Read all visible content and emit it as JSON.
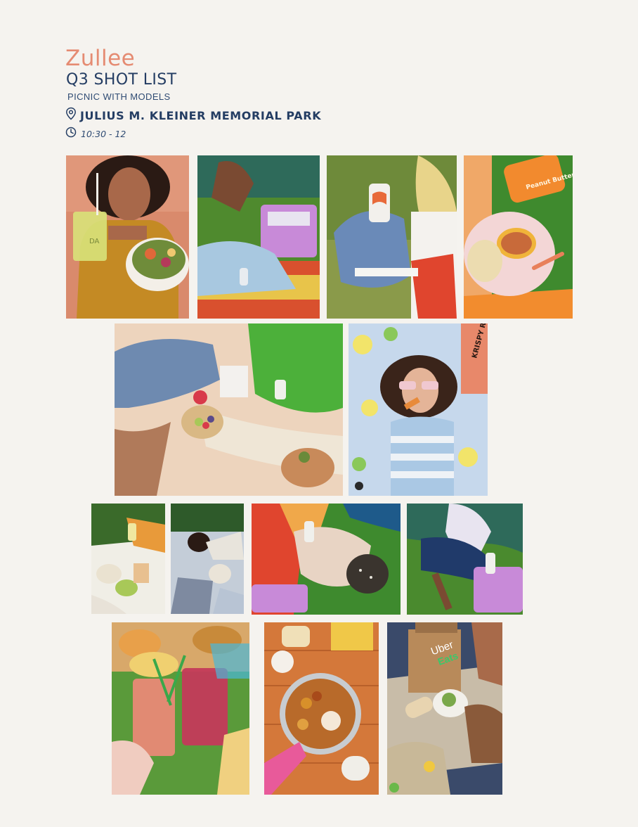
{
  "header": {
    "brand": "Zullee",
    "title": "Q3 SHOT LIST",
    "subtitle": "PICNIC WITH MODELS",
    "location": "JULIUS M. KLEINER MEMORIAL PARK",
    "time": "10:30 - 12"
  },
  "icons": {
    "location": "map-pin-icon",
    "time": "clock-icon"
  },
  "colors": {
    "brand": "#e58b72",
    "heading": "#243d63",
    "background": "#f5f3ef"
  },
  "photos": {
    "bottle": {
      "brand_text": "DA"
    },
    "pb_jar": {
      "brand_text": "Peanut Butter"
    },
    "krispy_box": {
      "brand_text": "KRISPY RICE"
    },
    "uber_bag": {
      "line1": "Uber",
      "line2": "Eats"
    }
  }
}
